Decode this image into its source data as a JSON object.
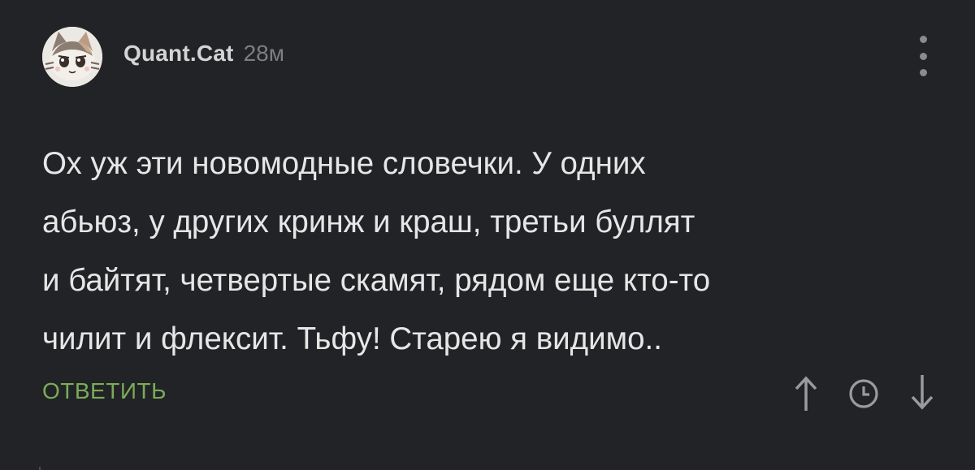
{
  "comment": {
    "author": "Quant.Cat",
    "time": "28м",
    "avatar_icon": "cat-avatar-icon",
    "more_icon": "vertical-dots-menu-icon",
    "lines": [
      "Ох уж эти новомодные словечки. У одних",
      "абьюз, у других кринж и краш, третьи буллят",
      "и байтят, четвертые скамят, рядом еще кто-то",
      "чилит и флексит. Тьфу! Старею я видимо.."
    ],
    "reply_label": "ОТВЕТИТЬ",
    "actions": {
      "upvote_icon": "arrow-up-icon",
      "history_icon": "clock-icon",
      "downvote_icon": "arrow-down-icon"
    }
  },
  "colors": {
    "background": "#222326",
    "text": "#e6e6e6",
    "username": "#d4d4d4",
    "muted": "#7d7e80",
    "reply": "#7bab5a"
  }
}
